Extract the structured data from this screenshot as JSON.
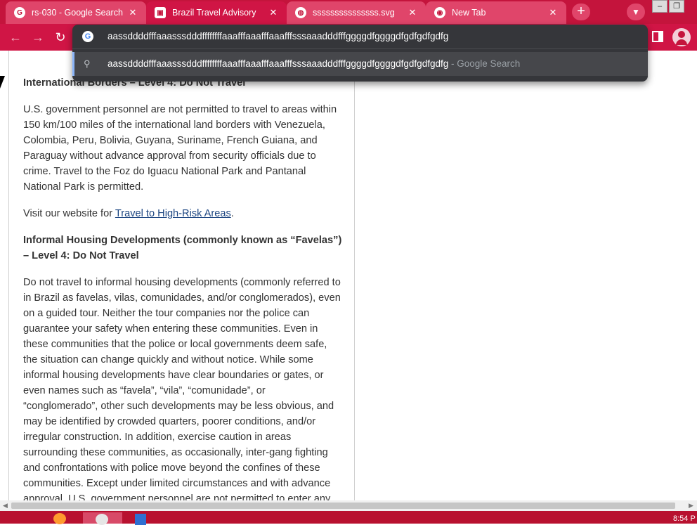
{
  "tabs": [
    {
      "title": "rs-030 - Google Search",
      "favicon": "google-icon",
      "active": false
    },
    {
      "title": "Brazil Travel Advisory",
      "favicon": "travel-advisory-icon",
      "active": true
    },
    {
      "title": "sssssssssssssss.svg",
      "favicon": "globe-icon",
      "active": false
    },
    {
      "title": "New Tab",
      "favicon": "chrome-icon",
      "active": false
    }
  ],
  "tab_close_glyph": "✕",
  "new_tab_glyph": "+",
  "omnibox": {
    "input_value": "aassddddfffaaasssdddffffffffaaafffaaafffaaafffsssaaadddfffggggdfggggdfgdfgdfgdfg",
    "suggestion_text": "aassddddfffaaasssdddffffffffaaafffaaafffaaafffsssaaadddfffggggdfggggdfgdfgdfgdfg",
    "suggestion_suffix": " - Google Search"
  },
  "article": {
    "h1": "International Borders – Level 4: Do Not Travel",
    "p1": "U.S. government personnel are not permitted to travel to areas within 150 km/100 miles of the international land borders with Venezuela, Colombia, Peru, Bolivia, Guyana, Suriname, French Guiana, and Paraguay without advance approval from security officials due to crime. Travel to the Foz do Iguacu National Park and Pantanal National Park is permitted.",
    "p2_prefix": "Visit our website for ",
    "p2_link": "Travel to High-Risk Areas",
    "p2_suffix": ".",
    "h2": "Informal Housing Developments (commonly known as “Favelas”) – Level 4: Do Not Travel",
    "p3": "Do not travel to informal housing developments (commonly referred to in Brazil as favelas, vilas, comunidades, and/or conglomerados), even on a guided tour.  Neither the tour companies nor the police can guarantee your safety when entering these communities.  Even in these communities that the police or local governments deem safe, the situation can change quickly and without notice.  While some informal housing developments have clear boundaries or gates, or even names such as “favela”, “vila”, “comunidade”, or “conglomerado”, other such developments may be less obvious, and may be identified by crowded quarters, poorer conditions, and/or irregular construction.  In addition, exercise caution in areas surrounding these communities, as occasionally, inter-gang fighting and confrontations with police move beyond the confines of these communities.  Except under limited circumstances and with advance approval, U.S. government personnel are not permitted to enter any informal housing developments in"
  },
  "taskbar": {
    "clock": "8:54 P"
  },
  "colors": {
    "brand": "#c4143c",
    "omnibox_bg": "#35363a",
    "link": "#1a4480"
  }
}
